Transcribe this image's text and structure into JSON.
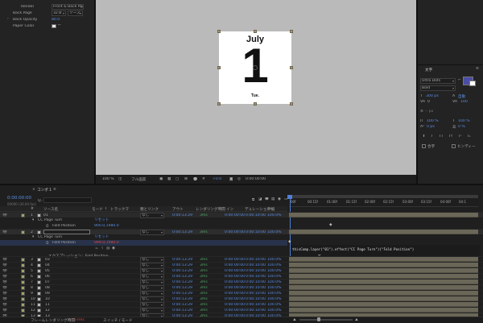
{
  "effect_controls": {
    "render_label": "Render",
    "render_value": "Front & Back Page",
    "back_page_label": "Back Page",
    "back_page_layer": "32.B",
    "back_page_source": "ソース",
    "back_opacity_label": "Back Opacity",
    "back_opacity_value": "80.0",
    "paper_color_label": "Paper Color",
    "eyedropper": "eyedropper-icon"
  },
  "comp_view": {
    "day_month": "July",
    "day_number": "1",
    "day_weekday": "Tue.",
    "paper_color": "#ffffff",
    "canvas_color": "#bababa",
    "bg_color": "#232323"
  },
  "viewer_toolbar": {
    "zoom": "100 %",
    "resolution": "フル画質",
    "view_value": "+0.0",
    "time_display": "0:00:00:00"
  },
  "character_panel": {
    "title": "文字",
    "font_family": "Ultra Dots",
    "font_style": "Bold",
    "font_size": "300 px",
    "tracking_auto": "自動",
    "leading_value": "100",
    "kerning": "0",
    "vscale": "100 %",
    "hscale": "100 %",
    "baseline": "0 px",
    "tsume": "0 %",
    "faux_styles": [
      "T",
      "T",
      "TT",
      "Tт",
      "T¹",
      "T₁"
    ],
    "ligature_label": "合字",
    "hindi_label": "ヒンディー",
    "swatch_color": "#4b4ea5",
    "stroke_color": "#ffffff"
  },
  "timeline": {
    "tab_close": "×",
    "tab_label": "コンポ 1",
    "tab_menu": "≡",
    "timecode": "0:00:00:00",
    "frame_info": "00000 (30.00 fps)",
    "search_placeholder": "Q₋",
    "headers": {
      "num": "#",
      "name": "ソース名",
      "mode": "モード",
      "t": "T",
      "trkmat": "トラックマ",
      "parent": "親とリンク",
      "label_in": "アウト",
      "stretch": "レンダリング時間",
      "duration_in": "イン",
      "duration_out": "デュレーション",
      "scale": "伸縮"
    },
    "ruler": [
      "00f",
      "00:15f",
      "01:00f",
      "01:15f",
      "02:00f",
      "02:15f",
      "03:00f",
      "03:15f",
      "04:00f",
      "04:1"
    ],
    "fold_layer": {
      "num": "1",
      "name": "01",
      "mode": "なし",
      "parent": "なし",
      "out": "0:00:13:29",
      "dur": "0:00:10:00",
      "in_t": "0:00:00:00",
      "stretch": "100.0%",
      "dur_t": "0:00:13:29"
    },
    "cc_effect": "CC Page Turn",
    "fold_position_label": "Fold Position",
    "fold_position_value": "900.0,1980.0",
    "reset": "リセット",
    "second_layer": {
      "num": "2",
      "mode": "なし",
      "out": "0:00:13:29",
      "dur": "0:00:10:00",
      "in_t": "0:00:00:00",
      "stretch": "100.0%"
    },
    "second_cc_effect": "CC Page Turn",
    "second_reset": "リセット",
    "second_fold_label": "Fold Position",
    "second_fold_value": "999.0,1980.0",
    "expression_label": "エクスプレッション：Fold Position",
    "expression_text": "thisComp.layer(\"01\").effect(\"CC Page Turn\")(\"Fold Position\")",
    "layers": [
      {
        "num": "3",
        "name": "03",
        "src": "03",
        "mode": "なし",
        "out": "0:00:13:29",
        "link": "0:00:13:29",
        "in_t": "0:00:00:00",
        "dur": "0:00:10:00",
        "stretch": "100.0%"
      },
      {
        "num": "4",
        "name": "04",
        "src": "04",
        "mode": "なし",
        "out": "0:00:13:29",
        "link": "0:00:13:29",
        "in_t": "0:00:00:00",
        "dur": "0:00:10:00",
        "stretch": "100.0%"
      },
      {
        "num": "5",
        "name": "05",
        "src": "05",
        "mode": "なし",
        "out": "0:00:13:29",
        "link": "0:00:13:29",
        "in_t": "0:00:00:00",
        "dur": "0:00:10:00",
        "stretch": "100.0%"
      },
      {
        "num": "6",
        "name": "06",
        "src": "06",
        "mode": "なし",
        "out": "0:00:13:29",
        "link": "0:00:13:29",
        "in_t": "0:00:00:00",
        "dur": "0:00:10:00",
        "stretch": "100.0%"
      },
      {
        "num": "7",
        "name": "07",
        "src": "07",
        "mode": "なし",
        "out": "0:00:13:29",
        "link": "0:00:13:29",
        "in_t": "0:00:00:00",
        "dur": "0:00:10:00",
        "stretch": "100.0%"
      },
      {
        "num": "8",
        "name": "08",
        "src": "08",
        "mode": "なし",
        "out": "0:00:13:29",
        "link": "0:00:13:29",
        "in_t": "0:00:00:00",
        "dur": "0:00:10:00",
        "stretch": "100.0%"
      },
      {
        "num": "9",
        "name": "09",
        "src": "09",
        "mode": "なし",
        "out": "0:00:13:29",
        "link": "0:00:13:29",
        "in_t": "0:00:00:00",
        "dur": "0:00:10:00",
        "stretch": "100.0%"
      },
      {
        "num": "10",
        "name": "10",
        "src": "10",
        "mode": "なし",
        "out": "0:00:13:29",
        "link": "0:00:13:29",
        "in_t": "0:00:00:00",
        "dur": "0:00:10:00",
        "stretch": "100.0%"
      },
      {
        "num": "11",
        "name": "11",
        "src": "11",
        "mode": "なし",
        "out": "0:00:13:29",
        "link": "0:00:13:29",
        "in_t": "0:00:00:00",
        "dur": "0:00:10:00",
        "stretch": "100.0%"
      },
      {
        "num": "12",
        "name": "12",
        "src": "12",
        "mode": "なし",
        "out": "0:00:13:29",
        "link": "0:00:13:29",
        "in_t": "0:00:00:00",
        "dur": "0:00:10:00",
        "stretch": "100.0%"
      },
      {
        "num": "13",
        "name": "13",
        "src": "13",
        "mode": "なし",
        "out": "0:00:13:29",
        "link": "0:00:13:29",
        "in_t": "0:00:00:00",
        "dur": "0:00:10:00",
        "stretch": "100.0%"
      }
    ],
    "footer_render": "フレームレンダリング時間",
    "footer_render_value": "57ms",
    "footer_toggle": "スイッチ / モード"
  },
  "colors": {
    "accent_blue": "#5b8ee6",
    "timecode_green": "#52a86a",
    "red": "#e04646",
    "layer_bar": "#6a6758"
  }
}
